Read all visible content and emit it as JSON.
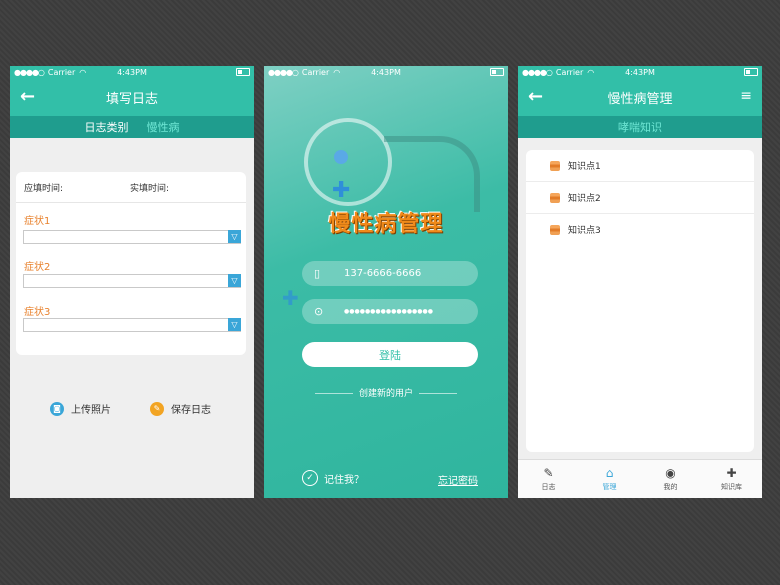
{
  "status": {
    "signal": "●●●●○",
    "carrier": "Carrier",
    "time": "4:43PM"
  },
  "diary": {
    "title": "填写日志",
    "tabs": [
      "日志类别",
      "慢性病"
    ],
    "due_time_label": "应填时间:",
    "actual_time_label": "实填时间:",
    "symptoms": [
      "症状1",
      "症状2",
      "症状3"
    ],
    "upload_label": "上传照片",
    "save_label": "保存日志"
  },
  "login": {
    "title": "慢性病管理",
    "phone_value": "137-6666-6666",
    "password_value": "●●●●●●●●●●●●●●●●●",
    "login_label": "登陆",
    "new_user_label": "创建新的用户",
    "remember_label": "记住我？",
    "forgot_label": "忘记密码"
  },
  "manage": {
    "title": "慢性病管理",
    "subtitle": "哮喘知识",
    "items": [
      "知识点1",
      "知识点2",
      "知识点3"
    ],
    "tabs": [
      "日志",
      "管理",
      "我的",
      "知识库"
    ]
  },
  "colors": {
    "teal": "#32bfa8",
    "teal_dark": "#1f9d8e",
    "orange": "#e8822e",
    "blue": "#3aa6d8"
  }
}
